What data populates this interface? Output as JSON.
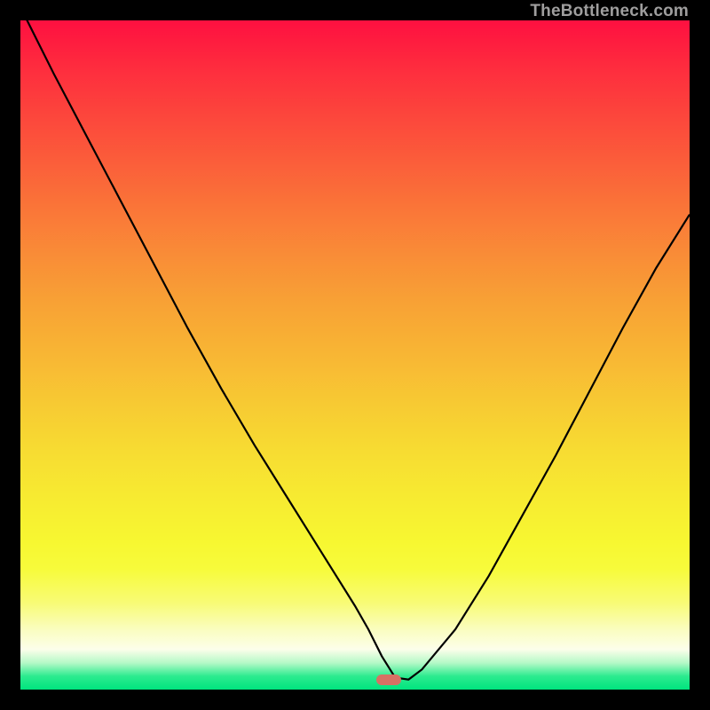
{
  "watermark": {
    "text": "TheBottleneck.com"
  },
  "marker": {
    "color": "#d77164",
    "min_x_pct": 55.0
  },
  "chart_data": {
    "type": "line",
    "title": "",
    "xlabel": "",
    "ylabel": "",
    "xlim": [
      0,
      100
    ],
    "ylim": [
      0,
      100
    ],
    "grid": false,
    "legend": false,
    "series": [
      {
        "name": "bottleneck-curve",
        "x": [
          0,
          5,
          10,
          15,
          20,
          25,
          30,
          35,
          40,
          45,
          50,
          52,
          54,
          56,
          58,
          60,
          65,
          70,
          75,
          80,
          85,
          90,
          95,
          100
        ],
        "y": [
          102,
          92,
          82.5,
          73,
          63.5,
          54,
          45,
          36.5,
          28.5,
          20.5,
          12.5,
          9,
          5,
          1.8,
          1.5,
          3,
          9,
          17,
          26,
          35,
          44.5,
          54,
          63,
          71
        ]
      }
    ],
    "annotations": [
      {
        "type": "watermark",
        "text": "TheBottleneck.com",
        "position": "top-right"
      }
    ]
  }
}
